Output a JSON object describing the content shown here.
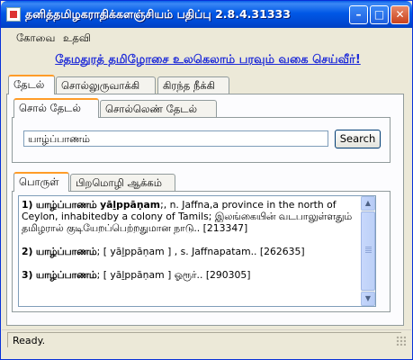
{
  "window": {
    "title": "தனித்தமிழகராதிக்களஞ்சியம் பதிப்பு 2.8.4.31333",
    "minimize_glyph": "–",
    "maximize_glyph": "□",
    "close_glyph": "✕"
  },
  "menu": {
    "items": [
      "கோவை",
      "உதவி"
    ]
  },
  "banner": "தேமதுரத் தமிழோசை உலகெலாம் பரவும் வகை செய்வீர்!",
  "main_tabs": [
    "தேடல்",
    "சொல்லுருவாக்கி",
    "கிரந்த நீக்கி"
  ],
  "search_tabs": [
    "சொல் தேடல்",
    "சொல்லெண் தேடல்"
  ],
  "search": {
    "value": "யாழ்ப்பாணம்",
    "button": "Search"
  },
  "result_tabs": [
    "பொருள்",
    "பிறமொழி ஆக்கம்"
  ],
  "results": [
    {
      "num": "1)",
      "word": "யாழ்ப்பாணம்",
      "translit": "yāḻppāṇam",
      "text": ";, n. Jaffna,a province in the north of Ceylon, inhabitedby a colony of Tamils; இலங்கையின் வடபாலுள்ளதும் தமிழரால் குடியேறப்பெற்றதுமான நாடு.. [213347]"
    },
    {
      "num": "2)",
      "word": "யாழ்ப்பாணம்",
      "translit": "",
      "text": "; [ yāḻppāṇam ] , s. Jaffnapatam.. [262635]"
    },
    {
      "num": "3)",
      "word": "யாழ்ப்பாணம்",
      "translit": "",
      "text": "; [ yāḻppāṇam ] ஓரூர்.. [290305]"
    }
  ],
  "status": "Ready.",
  "scroll": {
    "up_glyph": "▲",
    "down_glyph": "▼"
  }
}
